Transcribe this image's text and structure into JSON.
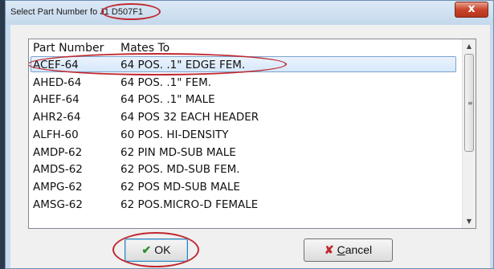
{
  "window": {
    "title": "Select Part Number fo",
    "title_highlighted": "J1 D507F1",
    "close_symbol": "x"
  },
  "list": {
    "columns": [
      "Part Number",
      "Mates To"
    ],
    "rows": [
      {
        "part": "ACEF-64",
        "mates": "64 POS. .1\" EDGE FEM.",
        "selected": true
      },
      {
        "part": "AHED-64",
        "mates": "64 POS. .1\" FEM."
      },
      {
        "part": "AHEF-64",
        "mates": "64 POS. .1\" MALE"
      },
      {
        "part": "AHR2-64",
        "mates": "64 POS 32 EACH HEADER"
      },
      {
        "part": "ALFH-60",
        "mates": "60 POS. HI-DENSITY"
      },
      {
        "part": "AMDP-62",
        "mates": "62 PIN MD-SUB MALE"
      },
      {
        "part": "AMDS-62",
        "mates": "62 POS. MD-SUB FEM."
      },
      {
        "part": "AMPG-62",
        "mates": "62 POS MD-SUB MALE"
      },
      {
        "part": "AMSG-62",
        "mates": "62 POS.MICRO-D FEMALE"
      }
    ]
  },
  "buttons": {
    "ok_label": "OK",
    "cancel_first": "C",
    "cancel_rest": "ancel"
  },
  "icons": {
    "ok": "checkmark-icon",
    "cancel": "x-mark-icon"
  },
  "colors": {
    "annotation": "#c0282f",
    "selection": "#d6e8fb",
    "ok_check": "#2f8f2f",
    "cancel_x": "#c0282f"
  }
}
